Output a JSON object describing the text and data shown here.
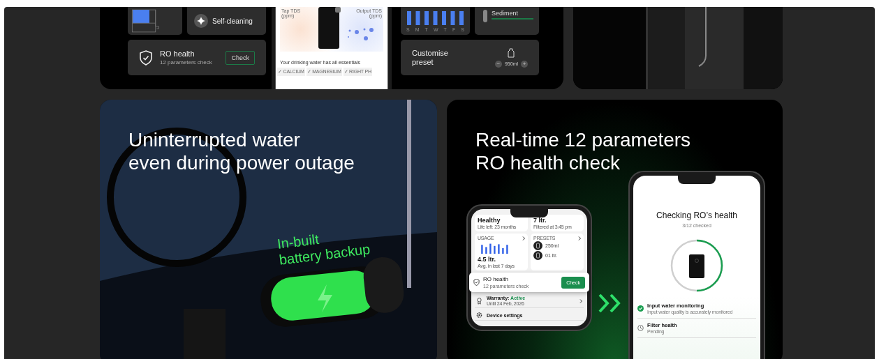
{
  "top_left_card": {
    "self_cleaning": {
      "label": "Self-cleaning"
    },
    "ro_health": {
      "title": "RO health",
      "subtitle": "12 parameters check",
      "button": "Check"
    },
    "phone_screen": {
      "tap_tds": "Tap TDS\n(ppm)",
      "output_tds": "Output TDS\n(ppm)",
      "message": "Your drinking water has all essentials",
      "chips": [
        "✓ CALCIUM",
        "✓ MAGNESIUM",
        "✓ RIGHT PH"
      ]
    },
    "usage": {
      "days": [
        "S",
        "M",
        "T",
        "W",
        "T",
        "F",
        "S"
      ]
    },
    "filter": {
      "label": "Sediment"
    },
    "preset": {
      "title": "Customise\npreset",
      "minus": "−",
      "amount": "950ml",
      "plus": "+"
    }
  },
  "battery_card": {
    "heading": "Uninterrupted water\neven during power outage",
    "callout": "In-built\nbattery backup"
  },
  "health_card": {
    "heading": "Real-time 12 parameters\nRO health check",
    "phone_app": {
      "status": "Healthy",
      "life": "Life left: 23 months",
      "filtered": "7 ltr.",
      "filtered_time": "Filtered at 3:45 pm",
      "usage_label": "USAGE",
      "usage_value": "4.5 ltr.",
      "usage_note": "Avg. in last 7 days",
      "presets_label": "PRESETS",
      "presets": [
        "250ml",
        "01 ltr."
      ],
      "ro_title": "RO health",
      "ro_subtitle": "12 parameters check",
      "ro_button": "Check",
      "warranty_label": "Warranty:",
      "warranty_status": "Active",
      "warranty_until": "Until 24 Feb, 2026",
      "settings": "Device settings"
    },
    "phone_check": {
      "title": "Checking RO’s health",
      "progress_text": "3/12 checked",
      "level": 0.5,
      "items": [
        {
          "kind": "done",
          "title": "Input water monitoring",
          "detail": "Input water quality is accurately monitored"
        },
        {
          "kind": "pending",
          "title": "Filter health",
          "detail": "Pending"
        }
      ]
    }
  }
}
